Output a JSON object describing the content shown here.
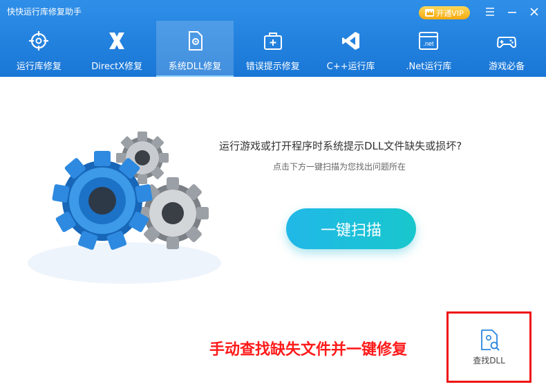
{
  "window": {
    "title": "快快运行库修复助手",
    "vip_label": "开通VIP"
  },
  "nav": {
    "items": [
      {
        "label": "运行库修复",
        "icon": "target-icon"
      },
      {
        "label": "DirectX修复",
        "icon": "directx-icon"
      },
      {
        "label": "系统DLL修复",
        "icon": "dll-file-icon",
        "active": true
      },
      {
        "label": "错误提示修复",
        "icon": "toolbox-icon"
      },
      {
        "label": "C++运行库",
        "icon": "visual-studio-icon"
      },
      {
        "label": ".Net运行库",
        "icon": "dotnet-icon"
      },
      {
        "label": "游戏必备",
        "icon": "gamepad-icon"
      }
    ]
  },
  "main": {
    "question": "运行游戏或打开程序时系统提示DLL文件缺失或损坏?",
    "hint": "点击下方一键扫描为您找出问题所在",
    "scan_button": "一键扫描",
    "promo": "手动查找缺失文件并一键修复",
    "find_dll_label": "查找DLL",
    "dotnet_icon_text": ".net"
  },
  "colors": {
    "header": "#1976d6",
    "scan_button": "#1fbfe0",
    "promo": "#ff1a1a",
    "highlight_border": "#e11111"
  }
}
